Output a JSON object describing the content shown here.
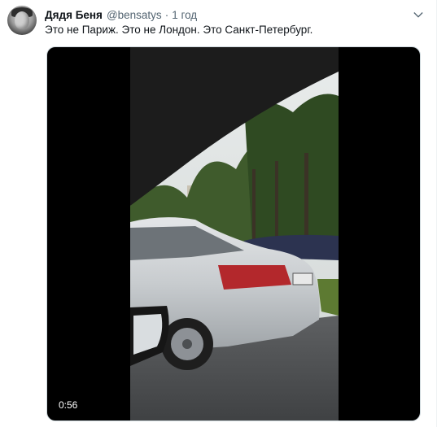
{
  "tweet": {
    "author_name": "Дядя Беня",
    "author_handle": "@bensatys",
    "separator": "·",
    "time": "1 год",
    "text": "Это не Париж. Это не Лондон. Это Санкт-Петербург.",
    "more_icon": "chevron-down-icon"
  },
  "media": {
    "duration": "0:56"
  },
  "colors": {
    "text_primary": "#0f1419",
    "text_secondary": "#536471",
    "media_background": "#000000"
  }
}
